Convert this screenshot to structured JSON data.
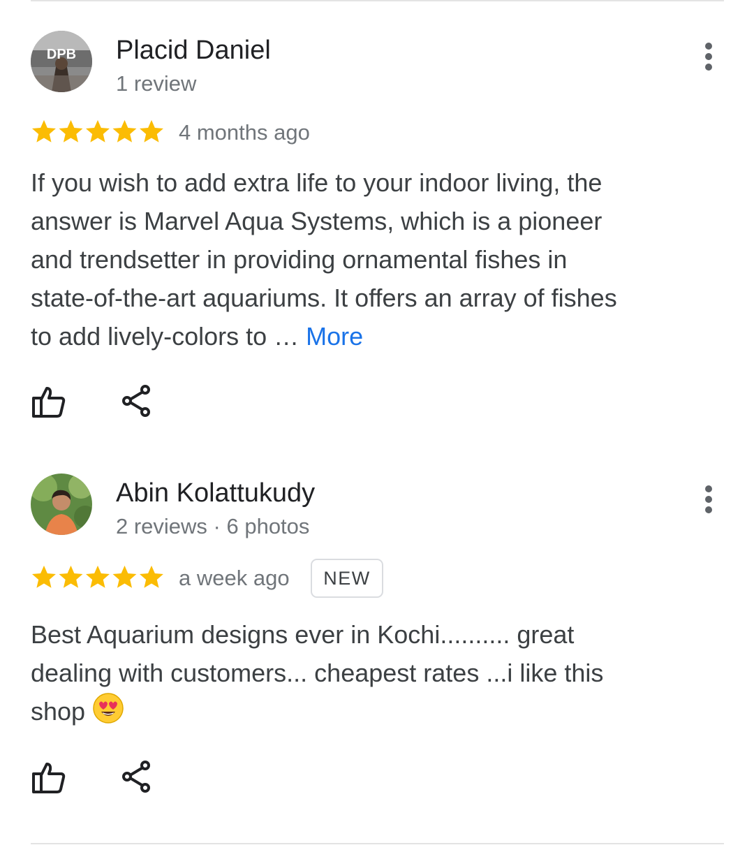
{
  "reviews": [
    {
      "reviewer_name": "Placid Daniel",
      "reviewer_meta": "1 review",
      "avatar_text": "DPB",
      "rating": 5,
      "date": "4 months ago",
      "text_lines": [
        "If you wish to add extra life to your indoor living, the",
        "answer is Marvel Aqua Systems, which is a pioneer",
        "and trendsetter in providing ornamental fishes in",
        "state-of-the-art aquariums. It offers an array of fishes",
        "to add lively-colors to … "
      ],
      "more_label": "More",
      "like_icon": "thumb-up-icon",
      "share_icon": "share-icon",
      "menu_icon": "more-vert-icon"
    },
    {
      "reviewer_name": "Abin Kolattukudy",
      "reviewer_meta": "2 reviews · 6 photos",
      "rating": 5,
      "date": "a week ago",
      "badge": "NEW",
      "text_lines": [
        "Best Aquarium designs ever in Kochi.......... great",
        "dealing with customers... cheapest rates ...i like this",
        "shop "
      ],
      "emoji": "smiling-face-with-heart-eyes",
      "like_icon": "thumb-up-icon",
      "share_icon": "share-icon",
      "menu_icon": "more-vert-icon"
    }
  ],
  "colors": {
    "star": "#fbbc04",
    "link": "#1a73e8",
    "text": "#3c4043",
    "meta": "#70757a"
  }
}
